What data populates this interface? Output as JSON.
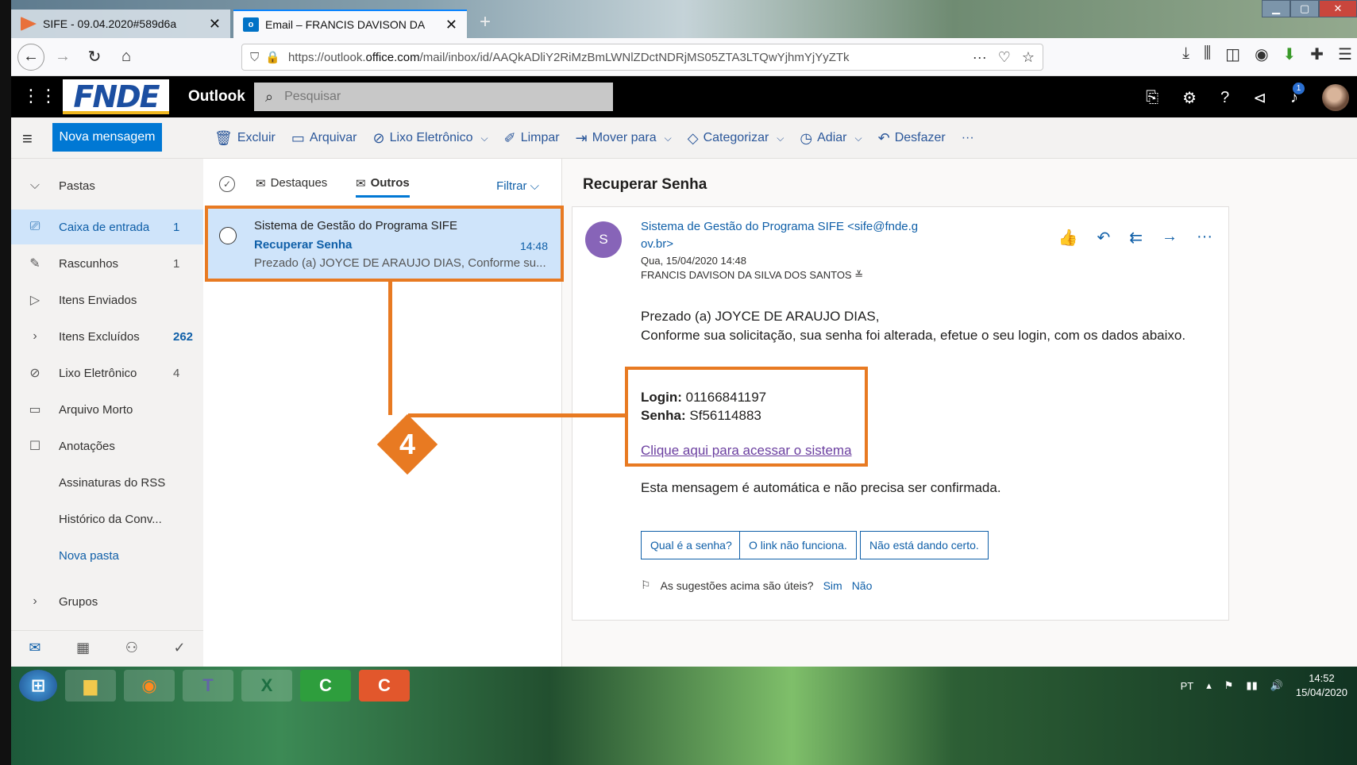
{
  "browser": {
    "tabs": [
      {
        "label": "SIFE - 09.04.2020#589d6a",
        "close": "✕"
      },
      {
        "label": "Email – FRANCIS DAVISON DA",
        "close": "✕"
      }
    ],
    "url_prefix": "https://outlook.",
    "url_domain": "office.com",
    "url_suffix": "/mail/inbox/id/AAQkADliY2RiMzBmLWNlZDctNDRjMS05ZTA3LTQwYjhmYjYyZTk",
    "new_tab": "+"
  },
  "outlook": {
    "logo_text": "FNDE",
    "app_name": "Outlook",
    "search_placeholder": "Pesquisar",
    "notification_count": "1"
  },
  "commands": {
    "new_message": "Nova mensagem",
    "items": [
      {
        "label": "Excluir",
        "icon": "trash-icon"
      },
      {
        "label": "Arquivar",
        "icon": "archive-icon"
      },
      {
        "label": "Lixo Eletrônico",
        "icon": "block-icon"
      },
      {
        "label": "Limpar",
        "icon": "broom-icon"
      },
      {
        "label": "Mover para",
        "icon": "move-icon"
      },
      {
        "label": "Categorizar",
        "icon": "tag-icon"
      },
      {
        "label": "Adiar",
        "icon": "clock-icon"
      },
      {
        "label": "Desfazer",
        "icon": "undo-icon"
      }
    ],
    "more": "···"
  },
  "folders": {
    "header": "Pastas",
    "items": [
      {
        "label": "Caixa de entrada",
        "count": "1"
      },
      {
        "label": "Rascunhos",
        "count": "1"
      },
      {
        "label": "Itens Enviados",
        "count": ""
      },
      {
        "label": "Itens Excluídos",
        "count": "262"
      },
      {
        "label": "Lixo Eletrônico",
        "count": "4"
      },
      {
        "label": "Arquivo Morto",
        "count": ""
      },
      {
        "label": "Anotações",
        "count": ""
      },
      {
        "label": "Assinaturas do RSS",
        "count": ""
      },
      {
        "label": "Histórico da Conv...",
        "count": ""
      },
      {
        "label": "Nova pasta",
        "count": ""
      }
    ],
    "groups": "Grupos"
  },
  "message_list": {
    "tab_focused": "Destaques",
    "tab_other": "Outros",
    "filter": "Filtrar",
    "message": {
      "sender": "Sistema de Gestão do Programa SIFE",
      "subject": "Recuperar Senha",
      "time": "14:48",
      "preview": "Prezado (a) JOYCE DE ARAUJO DIAS, Conforme su..."
    }
  },
  "reading": {
    "title": "Recuperar Senha",
    "avatar_letter": "S",
    "from_line1": "Sistema de Gestão do Programa SIFE <sife@fnde.g",
    "from_line2": "ov.br>",
    "date": "Qua, 15/04/2020 14:48",
    "to": "FRANCIS DAVISON DA SILVA DOS SANTOS ≚",
    "greeting": "Prezado (a) JOYCE DE ARAUJO DIAS,",
    "body_line": "Conforme sua solicitação, sua senha foi alterada, efetue o seu login, com os dados abaixo.",
    "login_label": "Login:",
    "login_value": " 01166841197",
    "password_label": "Senha:",
    "password_value": " Sf56114883",
    "link": "Clique aqui para acessar o sistema",
    "auto_msg": "Esta mensagem é automática e não precisa ser confirmada.",
    "suggestions": [
      "Qual é a senha?",
      "O link não funciona.",
      "Não está dando certo."
    ],
    "useful_q": "As sugestões acima são úteis?",
    "yes": "Sim",
    "no": "Não"
  },
  "annotation": {
    "number": "4",
    "color": "#e87a22"
  },
  "taskbar": {
    "lang": "PT",
    "time": "14:52",
    "date": "15/04/2020"
  }
}
